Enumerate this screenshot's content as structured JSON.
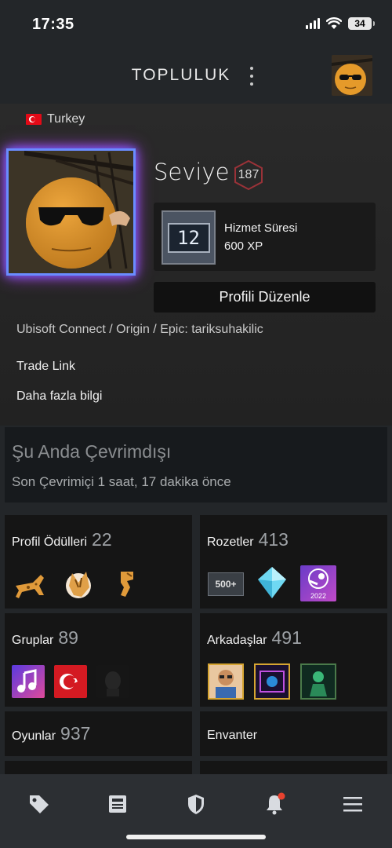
{
  "status_bar": {
    "time": "17:35",
    "battery": "34"
  },
  "header": {
    "title": "TOPLULUK"
  },
  "profile": {
    "country": "Turkey",
    "level_label": "Seviye",
    "level": "187",
    "service_badge_number": "12",
    "service_title": "Hizmet Süresi",
    "service_xp": "600 XP",
    "edit_button": "Profili Düzenle",
    "summary": "Ubisoft Connect / Origin / Epic: tariksuhakilic",
    "trade_link": "Trade Link",
    "more_info": "Daha fazla bilgi"
  },
  "status": {
    "title": "Şu Anda Çevrimdışı",
    "last_online": "Son Çevrimiçi 1 saat, 17 dakika önce"
  },
  "cards": {
    "awards": {
      "label": "Profil Ödülleri",
      "count": "22"
    },
    "badges": {
      "label": "Rozetler",
      "count": "413",
      "badge_500": "500+",
      "badge_2022": "2022"
    },
    "groups": {
      "label": "Gruplar",
      "count": "89"
    },
    "friends": {
      "label": "Arkadaşlar",
      "count": "491"
    },
    "games": {
      "label": "Oyunlar",
      "count": "937"
    },
    "inventory": {
      "label": "Envanter"
    }
  },
  "nav": {
    "items": [
      "tag-icon",
      "news-icon",
      "shield-icon",
      "bell-icon",
      "menu-icon"
    ],
    "notification_color": "#e8422f"
  }
}
